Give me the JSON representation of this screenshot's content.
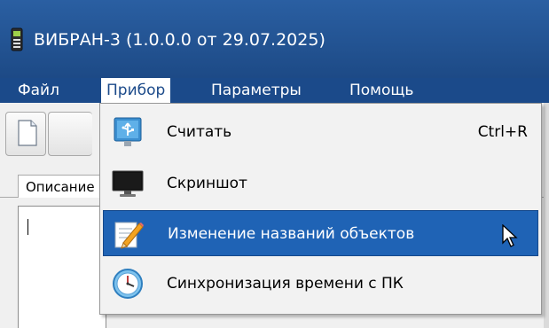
{
  "window": {
    "title": "ВИБРАН-3 (1.0.0.0 от 29.07.2025)",
    "app_icon": "device-icon"
  },
  "menubar": {
    "items": [
      {
        "label": "Файл"
      },
      {
        "label": "Прибор",
        "active": true
      },
      {
        "label": "Параметры"
      },
      {
        "label": "Помощь"
      }
    ]
  },
  "toolbar": {
    "new_icon": "new-document-icon"
  },
  "tabs": [
    {
      "label": "Описание"
    }
  ],
  "dropdown": {
    "items": [
      {
        "label": "Считать",
        "shortcut": "Ctrl+R",
        "icon": "usb-icon"
      },
      {
        "label": "Скриншот",
        "shortcut": "",
        "icon": "monitor-icon"
      },
      {
        "label": "Изменение названий объектов",
        "shortcut": "",
        "icon": "edit-pencil-icon",
        "highlighted": true
      },
      {
        "label": "Синхронизация времени с ПК",
        "shortcut": "",
        "icon": "clock-icon"
      }
    ]
  },
  "colors": {
    "titlebar": "#1f4e8c",
    "menubar": "#1b4a8a",
    "highlight": "#1f63b5"
  }
}
